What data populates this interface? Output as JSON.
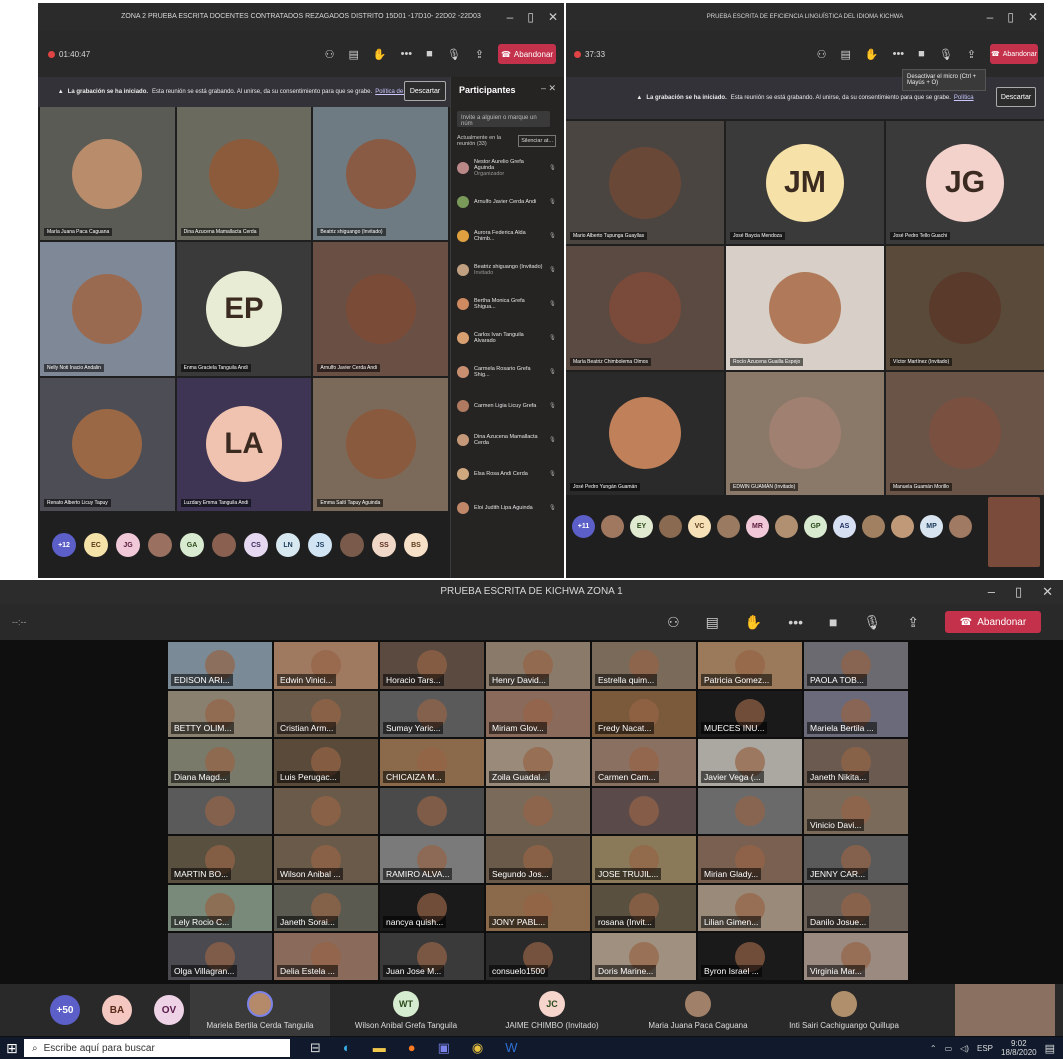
{
  "window1": {
    "title": "ZONA 2 PRUEBA ESCRITA DOCENTES CONTRATADOS REZAGADOS DISTRITO 15D01 -17D10- 22D02 -22D03",
    "timer": "01:40:47",
    "leave_label": "Abandonar",
    "banner_bold": "La grabación se ha iniciado.",
    "banner_text": "Esta reunión se está grabando. Al unirse, da su consentimiento para que se grabe.",
    "banner_link": "Política de privacidad",
    "discard_label": "Descartar",
    "tiles": [
      {
        "name": "María Juana Paca Caguana",
        "kind": "face",
        "bg": "#5a5b55",
        "face": "#b98c6c"
      },
      {
        "name": "Dina Azucena Mamallacta Cerda",
        "kind": "face",
        "bg": "#6a6b5e",
        "face": "#8c5b3c"
      },
      {
        "name": "Beatriz shiguango (Invitado)",
        "kind": "face",
        "bg": "#6f7b82",
        "face": "#8a5b44"
      },
      {
        "name": "Nelly Noti Inacio Andalin",
        "kind": "face",
        "bg": "#7f8896",
        "face": "#9a6a50"
      },
      {
        "name": "Enma Graciela Tanguila Andi",
        "kind": "initials",
        "initials": "EP",
        "bg": "#3a3a3a",
        "circle": "#e8ecd4"
      },
      {
        "name": "Arnulfo Javier Cerda Andi",
        "kind": "face",
        "bg": "#6a4f45",
        "face": "#7a4c38"
      },
      {
        "name": "Renato Alberto Licuy Tapuy",
        "kind": "face",
        "bg": "#4d4d55",
        "face": "#9a6845"
      },
      {
        "name": "Luzdary Emma Tanguila Andi",
        "kind": "initials",
        "initials": "LA",
        "bg": "#3d3553",
        "circle": "#f0c2b0"
      },
      {
        "name": "Emma Saltí Tapuy Aguinda",
        "kind": "face",
        "bg": "#7b6a5a",
        "face": "#8a5a3e"
      }
    ],
    "roster": [
      {
        "label": "+12",
        "bg": "#5b5fc7",
        "fg": "#fff"
      },
      {
        "label": "EC",
        "bg": "#f4e2a8",
        "fg": "#5a3a1a"
      },
      {
        "label": "JG",
        "bg": "#f0c8d8",
        "fg": "#5a1a3a"
      },
      {
        "label": "",
        "bg": "#9a7060",
        "fg": "#fff"
      },
      {
        "label": "GA",
        "bg": "#d8ead0",
        "fg": "#2a4a1a"
      },
      {
        "label": "",
        "bg": "#8a6050",
        "fg": "#fff"
      },
      {
        "label": "CS",
        "bg": "#e6d8f0",
        "fg": "#3a2a5a"
      },
      {
        "label": "LN",
        "bg": "#d8e8f0",
        "fg": "#1a3a5a"
      },
      {
        "label": "JS",
        "bg": "#d0e4f4",
        "fg": "#1a3a5a"
      },
      {
        "label": "",
        "bg": "#7a5a4a",
        "fg": "#fff"
      },
      {
        "label": "SS",
        "bg": "#f0d8c8",
        "fg": "#5a2a1a"
      },
      {
        "label": "BS",
        "bg": "#f6e0c8",
        "fg": "#5a3a1a"
      }
    ],
    "panel": {
      "title": "Participantes",
      "invite_placeholder": "Invite a alguien o marque un núm",
      "section_label": "Actualmente en la reunión (33)",
      "mute_all": "Silenciar at...",
      "people": [
        {
          "name": "Nestor Aurelio Grefa Aguinda",
          "sub": "Organizador",
          "color": "#b88"
        },
        {
          "name": "Arnulfo Javier Cerda Andi",
          "sub": "",
          "color": "#7a9a5a"
        },
        {
          "name": "Aurora Federica Alda Chimb...",
          "sub": "",
          "color": "#e0a040"
        },
        {
          "name": "Beatriz shiguango (Invitado)",
          "sub": "Invitado",
          "color": "#c0a080"
        },
        {
          "name": "Bertha Monica Grefa Shigua...",
          "sub": "",
          "color": "#d08a60"
        },
        {
          "name": "Carlos Ivan Tanguila Alvarado",
          "sub": "",
          "color": "#d8a070"
        },
        {
          "name": "Carmela Rosario Grefa Shig...",
          "sub": "",
          "color": "#c89070"
        },
        {
          "name": "Carmen Ligia Licuy Grefa",
          "sub": "",
          "color": "#b07a60"
        },
        {
          "name": "Dina Azucena Mamallacta Cerda",
          "sub": "",
          "color": "#c49878"
        },
        {
          "name": "Elsa Rosa Andi Cerda",
          "sub": "",
          "color": "#d0a880"
        },
        {
          "name": "Eloi Judith Lipa Aguinda",
          "sub": "",
          "color": "#c08868"
        }
      ]
    }
  },
  "window2": {
    "title": "PRUEBA ESCRITA DE EFICIENCIA LINGUÍSTICA DEL IDIOMA KICHWA",
    "timer": "37:33",
    "leave_label": "Abandonar",
    "banner_bold": "La grabación se ha iniciado.",
    "banner_text": "Esta reunión se está grabando. Al unirse, da su consentimiento para que se grabe.",
    "banner_link": "Política",
    "discard_label": "Descartar",
    "tooltip": "Desactivar el micro (Ctrl + Mayús + O)",
    "tiles": [
      {
        "name": "Mario Alberto Tupunga Guayllas",
        "kind": "face",
        "bg": "#4a4540",
        "face": "#6a4838"
      },
      {
        "name": "José Baycia Mendoza",
        "kind": "initials",
        "initials": "JM",
        "bg": "#3a3a3a",
        "circle": "#f6e1a8"
      },
      {
        "name": "José Pedro Tello Guachi",
        "kind": "initials",
        "initials": "JG",
        "bg": "#3a3a3a",
        "circle": "#f3d2cc"
      },
      {
        "name": "María Beatriz Chimbolema Olmos",
        "kind": "face",
        "bg": "#5a4a42",
        "face": "#7a4a3a"
      },
      {
        "name": "Rocío Azucena Guailla Espejo",
        "kind": "face",
        "bg": "#d8d0c8",
        "face": "#b07a5a"
      },
      {
        "name": "Víctor Martínez (Invitado)",
        "kind": "face",
        "bg": "#5a4a3a",
        "face": "#5a3a2a"
      },
      {
        "name": "José Pedro Yungán Guamán",
        "kind": "face",
        "bg": "#2a2a2a",
        "face": "#c0805a"
      },
      {
        "name": "EDWIN GUAMÁN (Invitado)",
        "kind": "face",
        "bg": "#8a7868",
        "face": "#a08070"
      },
      {
        "name": "Manuela Guamán Morillo",
        "kind": "face",
        "bg": "#6a5448",
        "face": "#7a5040"
      }
    ],
    "roster": [
      {
        "label": "+11",
        "bg": "#5b5fc7",
        "fg": "#fff"
      },
      {
        "label": "",
        "bg": "#a07860",
        "fg": "#fff"
      },
      {
        "label": "EY",
        "bg": "#e0ead0",
        "fg": "#2a4a1a"
      },
      {
        "label": "",
        "bg": "#8a6a50",
        "fg": "#fff"
      },
      {
        "label": "VC",
        "bg": "#f6e0b8",
        "fg": "#5a3a1a"
      },
      {
        "label": "",
        "bg": "#9a7a60",
        "fg": "#fff"
      },
      {
        "label": "MR",
        "bg": "#f0c8d8",
        "fg": "#5a1a3a"
      },
      {
        "label": "",
        "bg": "#b09070",
        "fg": "#fff"
      },
      {
        "label": "GP",
        "bg": "#d8ead0",
        "fg": "#2a4a1a"
      },
      {
        "label": "AS",
        "bg": "#d8e0f4",
        "fg": "#1a2a5a"
      },
      {
        "label": "",
        "bg": "#a08060",
        "fg": "#fff"
      },
      {
        "label": "",
        "bg": "#c09a78",
        "fg": "#fff"
      },
      {
        "label": "MP",
        "bg": "#d8e4f0",
        "fg": "#1a3a5a"
      },
      {
        "label": "",
        "bg": "#a07a62",
        "fg": "#fff"
      }
    ]
  },
  "window3": {
    "title": "PRUEBA ESCRITA DE KICHWA ZONA 1",
    "timer": "--:--",
    "leave_label": "Abandonar",
    "tiles": [
      {
        "name": "EDISON ARI...",
        "bg": "#7a8a96"
      },
      {
        "name": "Edwin Vinici...",
        "bg": "#a07a60"
      },
      {
        "name": "Horacio Tars...",
        "bg": "#5a4a40"
      },
      {
        "name": "Henry David...",
        "bg": "#8a7a6a"
      },
      {
        "name": "Estrella quim...",
        "bg": "#7a6a5a"
      },
      {
        "name": "Patricia Gomez...",
        "bg": "#9a7a5a"
      },
      {
        "name": "PAOLA TOB...",
        "bg": "#6a6a70"
      },
      {
        "name": "BETTY OLIM...",
        "bg": "#8a8070"
      },
      {
        "name": "Cristian Arm...",
        "bg": "#6a5a4a"
      },
      {
        "name": "Sumay Yaric...",
        "bg": "#5a5a5a"
      },
      {
        "name": "Miriam Glov...",
        "bg": "#8a6a5a"
      },
      {
        "name": "Fredy Nacat...",
        "bg": "#7a5a3a"
      },
      {
        "name": "MUECES INU...",
        "bg": "#1a1a1a"
      },
      {
        "name": "Mariela Bertila ...",
        "bg": "#6a6a7a"
      },
      {
        "name": "Diana Magd...",
        "bg": "#7a7a6a"
      },
      {
        "name": "Luis Perugac...",
        "bg": "#5a4a3a"
      },
      {
        "name": "CHICAIZA M...",
        "bg": "#8a6a4a"
      },
      {
        "name": "Zoila Guadal...",
        "bg": "#9a8a7a"
      },
      {
        "name": "Carmen Cam...",
        "bg": "#8a7060"
      },
      {
        "name": "Javier Vega (...",
        "bg": "#aaa8a0"
      },
      {
        "name": "Janeth Nikita...",
        "bg": "#6a5a50"
      },
      {
        "name": "",
        "bg": "#5a5a5a"
      },
      {
        "name": "",
        "bg": "#6a5a4a"
      },
      {
        "name": "",
        "bg": "#4a4a4a"
      },
      {
        "name": "",
        "bg": "#7a6a5a"
      },
      {
        "name": "",
        "bg": "#5a4a4a"
      },
      {
        "name": "",
        "bg": "#6a6a6a"
      },
      {
        "name": "Vinicio Davi...",
        "bg": "#7a6a5a"
      },
      {
        "name": "MARTIN BO...",
        "bg": "#5a5040"
      },
      {
        "name": "Wilson Anibal ...",
        "bg": "#6a5a4a"
      },
      {
        "name": "RAMIRO ALVA...",
        "bg": "#7a7a7a"
      },
      {
        "name": "Segundo Jos...",
        "bg": "#6a5a4a"
      },
      {
        "name": "JOSE TRUJIL...",
        "bg": "#8a7a5a"
      },
      {
        "name": "Mirian Glady...",
        "bg": "#7a6050"
      },
      {
        "name": "JENNY CAR...",
        "bg": "#5a5a5a"
      },
      {
        "name": "Lely Rocio C...",
        "bg": "#7a8a7a"
      },
      {
        "name": "Janeth Sorai...",
        "bg": "#5a5a50"
      },
      {
        "name": "nancya quish...",
        "bg": "#1a1a1a"
      },
      {
        "name": "JONY PABL...",
        "bg": "#8a6a4a"
      },
      {
        "name": "rosana (Invit...",
        "bg": "#5a5040"
      },
      {
        "name": "Lilian Gimen...",
        "bg": "#9a8a7a"
      },
      {
        "name": "Danilo Josue...",
        "bg": "#6a6058"
      },
      {
        "name": "Olga Villagran...",
        "bg": "#4a4a50"
      },
      {
        "name": "Delia Estela ...",
        "bg": "#8a6a5a"
      },
      {
        "name": "Juan Jose M...",
        "bg": "#3a3a3a"
      },
      {
        "name": "consuelo1500",
        "bg": "#2a2a2a"
      },
      {
        "name": "Doris Marine...",
        "bg": "#a09080"
      },
      {
        "name": "Byron Israel ...",
        "bg": "#1a1a1a"
      },
      {
        "name": "Virginia Mar...",
        "bg": "#9a8a80"
      }
    ],
    "roster_bubbles": [
      {
        "label": "+50",
        "bg": "#5b5fc7",
        "fg": "#fff"
      },
      {
        "label": "BA",
        "bg": "#f4c8c0",
        "fg": "#5a2a1a"
      },
      {
        "label": "OV",
        "bg": "#eed2e6",
        "fg": "#5a1a4a"
      }
    ],
    "roster_named": [
      {
        "initials": "",
        "name": "Mariela Bertila Cerda Tanguila",
        "bg": "#b58a6a",
        "active": true
      },
      {
        "initials": "WT",
        "name": "Wilson Anibal Grefa Tanguila",
        "bg": "#d6ecd0",
        "active": false
      },
      {
        "initials": "JC",
        "name": "JAIME CHIMBO (Invitado)",
        "bg": "#f6d6cc",
        "active": false
      },
      {
        "initials": "",
        "name": "Maria Juana Paca Caguana",
        "bg": "#a08068",
        "active": false
      },
      {
        "initials": "",
        "name": "Inti Sairi Cachiguango Quillupa",
        "bg": "#b0906c",
        "active": false
      }
    ]
  },
  "taskbar": {
    "search_placeholder": "Escribe aquí para buscar",
    "lang": "ESP",
    "time": "9:02",
    "date": "18/8/2020"
  }
}
